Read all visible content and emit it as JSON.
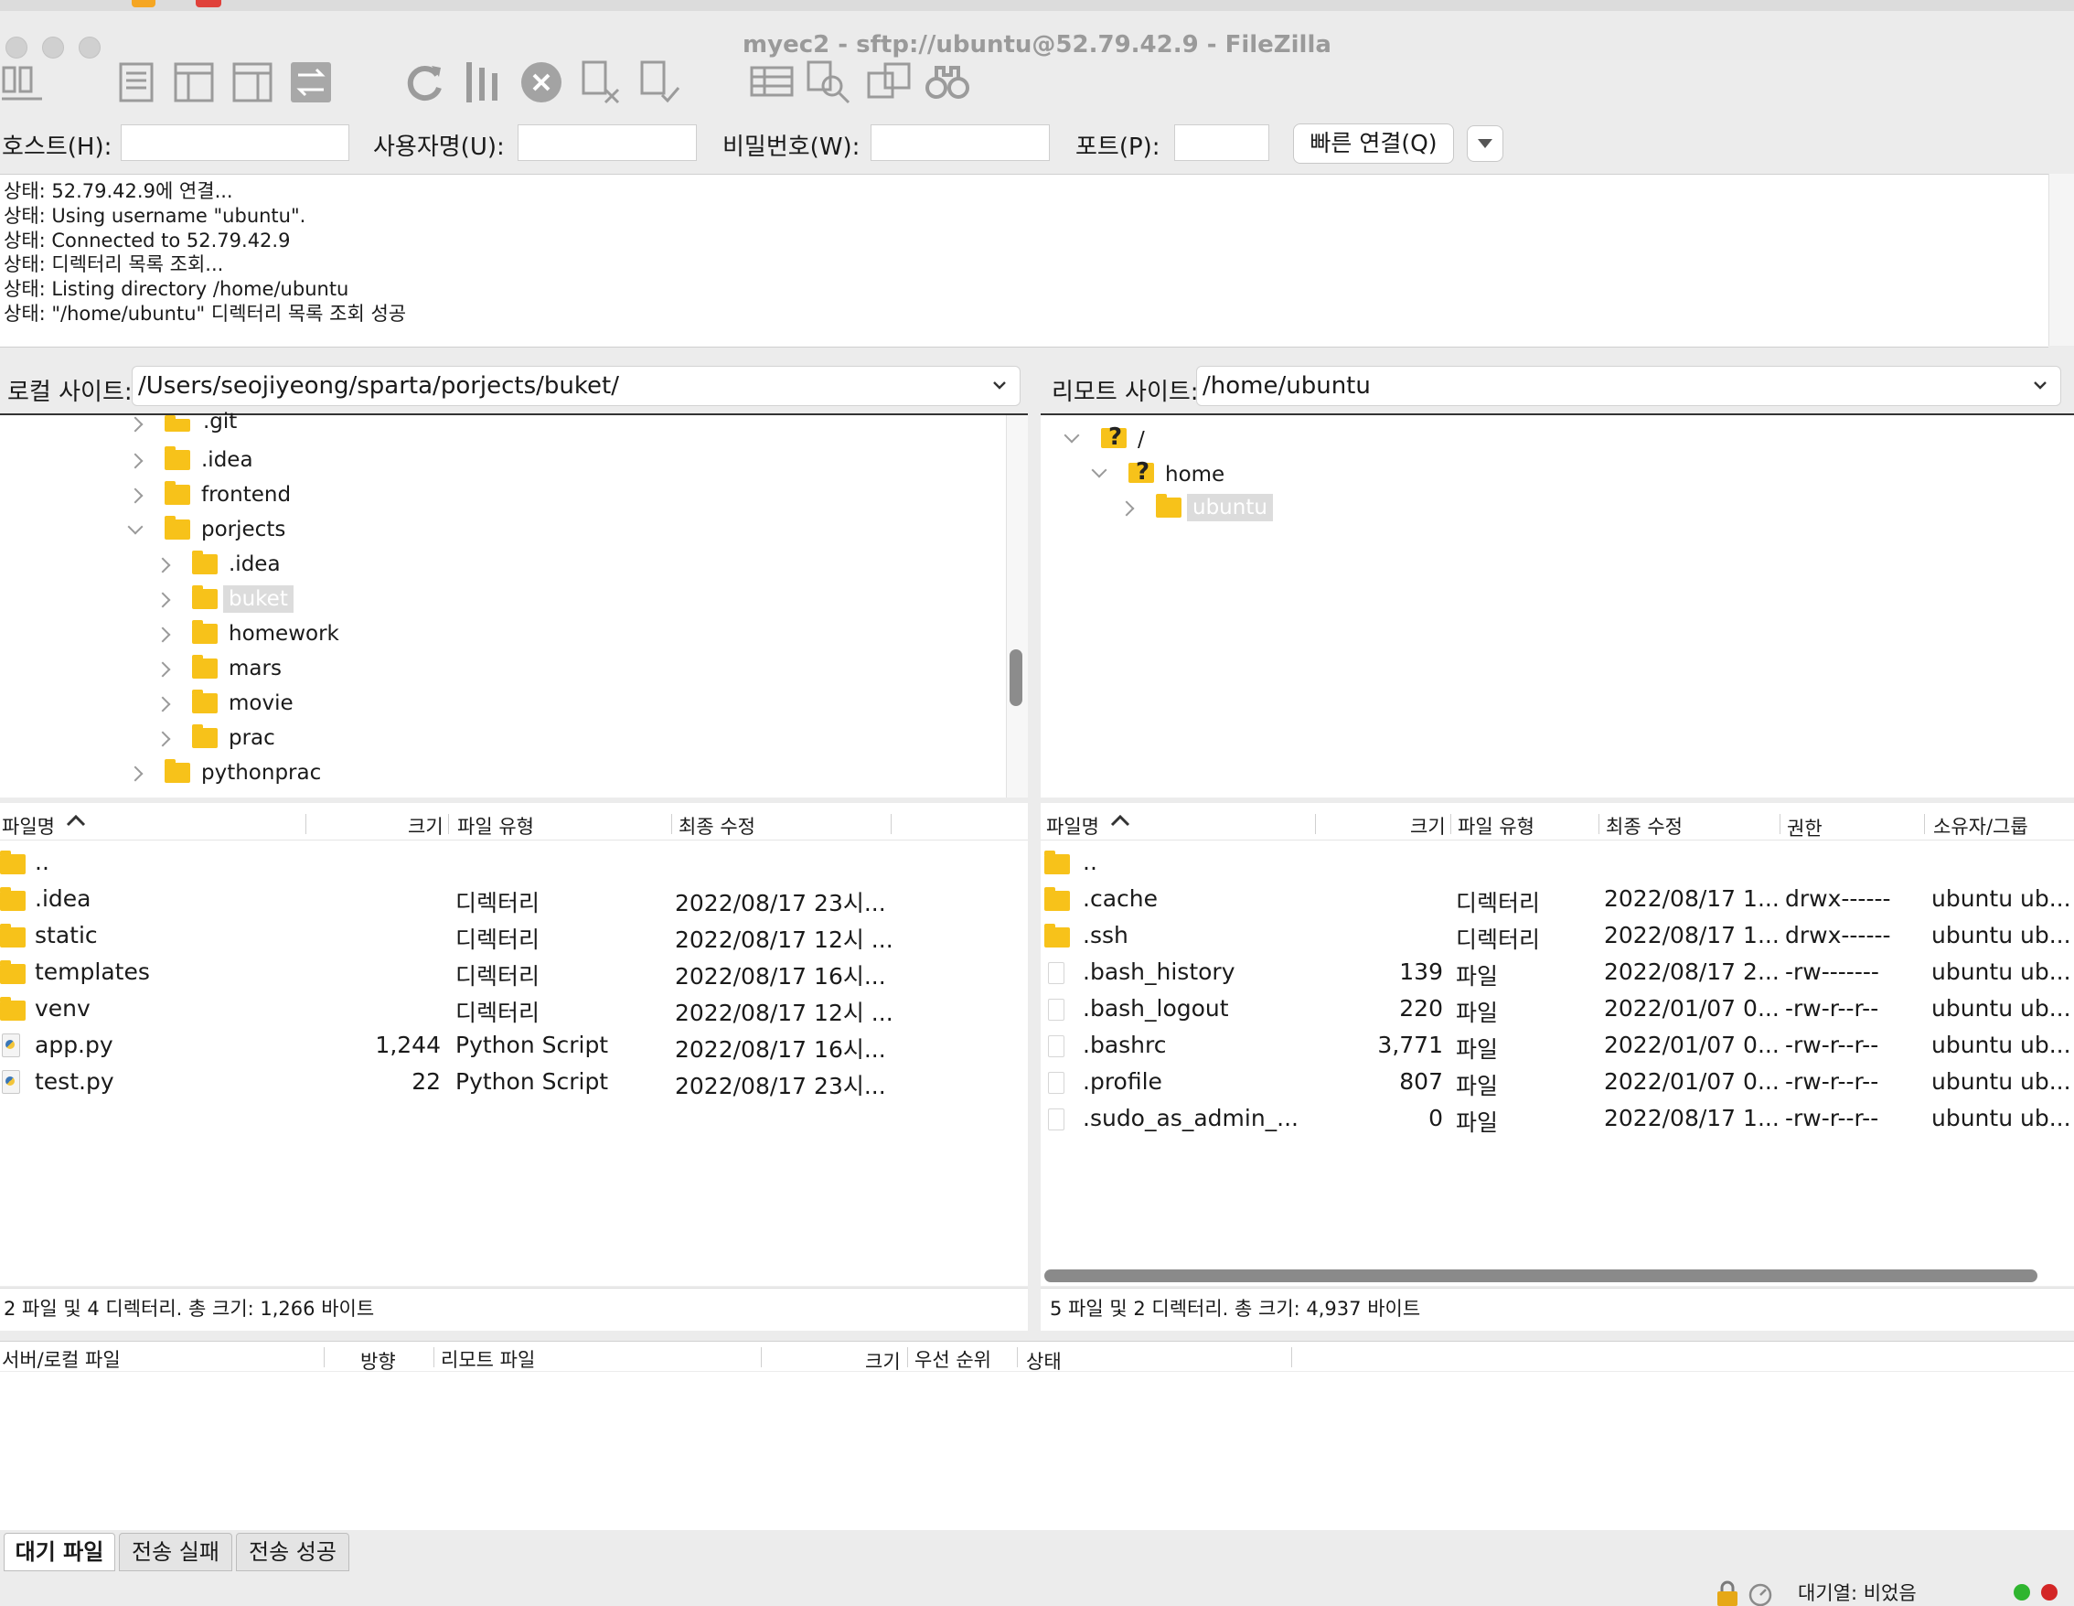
{
  "window": {
    "title": "myec2 - sftp://ubuntu@52.79.42.9 - FileZilla"
  },
  "toolbar": {
    "icons": [
      "site-manager-icon",
      "toggle-log-icon",
      "toggle-local-tree-icon",
      "toggle-remote-tree-icon",
      "transfer-queue-icon",
      "refresh-icon",
      "process-queue-icon",
      "cancel-icon",
      "disconnect-icon",
      "reconnect-icon",
      "directory-listing-icon",
      "compare-icon",
      "sync-browse-icon",
      "search-icon"
    ]
  },
  "quickconnect": {
    "host_label": "호스트(H):",
    "user_label": "사용자명(U):",
    "pass_label": "비밀번호(W):",
    "port_label": "포트(P):",
    "host_value": "",
    "user_value": "",
    "pass_value": "",
    "port_value": "",
    "connect_label": "빠른 연결(Q)"
  },
  "log": [
    "상태:  52.79.42.9에 연결...",
    "상태:  Using username \"ubuntu\".",
    "상태:  Connected to 52.79.42.9",
    "상태:  디렉터리 목록 조회...",
    "상태:  Listing directory /home/ubuntu",
    "상태:  \"/home/ubuntu\" 디렉터리 목록 조회 성공"
  ],
  "local": {
    "label": "로컬 사이트:",
    "path": "/Users/seojiyeong/sparta/porjects/buket/",
    "tree": [
      {
        "name": ".git",
        "depth": 0,
        "expanded": false
      },
      {
        "name": ".idea",
        "depth": 0,
        "expanded": false
      },
      {
        "name": "frontend",
        "depth": 0,
        "expanded": false
      },
      {
        "name": "porjects",
        "depth": 0,
        "expanded": true
      },
      {
        "name": ".idea",
        "depth": 1,
        "expanded": false
      },
      {
        "name": "buket",
        "depth": 1,
        "expanded": false,
        "selected": true
      },
      {
        "name": "homework",
        "depth": 1,
        "expanded": false
      },
      {
        "name": "mars",
        "depth": 1,
        "expanded": false
      },
      {
        "name": "movie",
        "depth": 1,
        "expanded": false
      },
      {
        "name": "prac",
        "depth": 1,
        "expanded": false
      },
      {
        "name": "pythonprac",
        "depth": 0,
        "expanded": false
      }
    ],
    "columns": {
      "name": "파일명",
      "size": "크기",
      "type": "파일 유형",
      "modified": "최종 수정"
    },
    "files": [
      {
        "name": "..",
        "size": "",
        "type": "",
        "modified": "",
        "kind": "folder"
      },
      {
        "name": ".idea",
        "size": "",
        "type": "디렉터리",
        "modified": "2022/08/17 23시...",
        "kind": "folder"
      },
      {
        "name": "static",
        "size": "",
        "type": "디렉터리",
        "modified": "2022/08/17 12시 ...",
        "kind": "folder"
      },
      {
        "name": "templates",
        "size": "",
        "type": "디렉터리",
        "modified": "2022/08/17 16시...",
        "kind": "folder"
      },
      {
        "name": "venv",
        "size": "",
        "type": "디렉터리",
        "modified": "2022/08/17 12시 ...",
        "kind": "folder"
      },
      {
        "name": "app.py",
        "size": "1,244",
        "type": "Python Script",
        "modified": "2022/08/17 16시...",
        "kind": "py"
      },
      {
        "name": "test.py",
        "size": "22",
        "type": "Python Script",
        "modified": "2022/08/17 23시...",
        "kind": "py"
      }
    ],
    "status": "2 파일 및 4 디렉터리. 총 크기: 1,266 바이트"
  },
  "remote": {
    "label": "리모트 사이트:",
    "path": "/home/ubuntu",
    "tree": [
      {
        "name": "/",
        "depth": 0,
        "expanded": true,
        "unknown": true
      },
      {
        "name": "home",
        "depth": 1,
        "expanded": true,
        "unknown": true
      },
      {
        "name": "ubuntu",
        "depth": 2,
        "expanded": false,
        "selected": true
      }
    ],
    "columns": {
      "name": "파일명",
      "size": "크기",
      "type": "파일 유형",
      "modified": "최종 수정",
      "perm": "권한",
      "owner": "소유자/그룹"
    },
    "files": [
      {
        "name": "..",
        "size": "",
        "type": "",
        "modified": "",
        "perm": "",
        "owner": "",
        "kind": "folder"
      },
      {
        "name": ".cache",
        "size": "",
        "type": "디렉터리",
        "modified": "2022/08/17 1...",
        "perm": "drwx------",
        "owner": "ubuntu ub...",
        "kind": "folder"
      },
      {
        "name": ".ssh",
        "size": "",
        "type": "디렉터리",
        "modified": "2022/08/17 1...",
        "perm": "drwx------",
        "owner": "ubuntu ub...",
        "kind": "folder"
      },
      {
        "name": ".bash_history",
        "size": "139",
        "type": "파일",
        "modified": "2022/08/17 2...",
        "perm": "-rw-------",
        "owner": "ubuntu ub...",
        "kind": "file"
      },
      {
        "name": ".bash_logout",
        "size": "220",
        "type": "파일",
        "modified": "2022/01/07 0...",
        "perm": "-rw-r--r--",
        "owner": "ubuntu ub...",
        "kind": "file"
      },
      {
        "name": ".bashrc",
        "size": "3,771",
        "type": "파일",
        "modified": "2022/01/07 0...",
        "perm": "-rw-r--r--",
        "owner": "ubuntu ub...",
        "kind": "file"
      },
      {
        "name": ".profile",
        "size": "807",
        "type": "파일",
        "modified": "2022/01/07 0...",
        "perm": "-rw-r--r--",
        "owner": "ubuntu ub...",
        "kind": "file"
      },
      {
        "name": ".sudo_as_admin_...",
        "size": "0",
        "type": "파일",
        "modified": "2022/08/17 1...",
        "perm": "-rw-r--r--",
        "owner": "ubuntu ub...",
        "kind": "file"
      }
    ],
    "status": "5 파일 및 2 디렉터리. 총 크기: 4,937 바이트"
  },
  "queue": {
    "columns": {
      "server_file": "서버/로컬 파일",
      "direction": "방향",
      "remote_file": "리모트 파일",
      "size": "크기",
      "priority": "우선 순위",
      "status": "상태"
    },
    "tabs": [
      "대기 파일",
      "전송 실패",
      "전송 성공"
    ],
    "active_tab": 0
  },
  "statusbar": {
    "queue": "대기열: 비었음"
  },
  "colors": {
    "folder": "#f7c21a",
    "selected": "#dcdcdc",
    "led_green": "#2fb52f",
    "led_red": "#d32626"
  }
}
